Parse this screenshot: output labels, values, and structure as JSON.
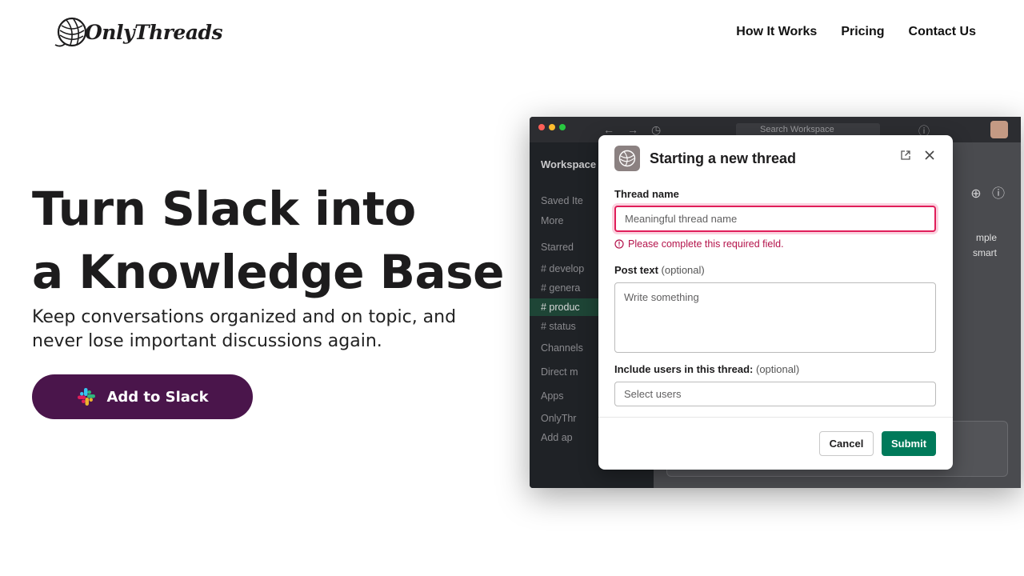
{
  "header": {
    "logo_text": "OnlyThreads",
    "nav": [
      "How It Works",
      "Pricing",
      "Contact Us"
    ]
  },
  "hero": {
    "title_line1": "Turn Slack into",
    "title_line2": "a Knowledge Base",
    "subtitle": "Keep conversations organized and on topic, and never lose important discussions again.",
    "cta_label": "Add to Slack",
    "cta_color": "#4a154b"
  },
  "app_window": {
    "search_placeholder": "Search Workspace",
    "workspace_name": "Workspace",
    "sidebar_items": [
      "Saved Ite",
      "More",
      "Starred",
      "# develop",
      "# genera",
      "# produc",
      "# status",
      "Channels",
      "Direct m",
      "Apps",
      "OnlyThr",
      "Add ap"
    ],
    "main_text_lines": [
      "mple",
      "smart"
    ]
  },
  "modal": {
    "title": "Starting a new thread",
    "thread_name_label": "Thread name",
    "thread_name_placeholder": "Meaningful thread name",
    "thread_name_value": "",
    "error_text": "Please complete this required field.",
    "post_text_label": "Post text",
    "post_text_optional": "(optional)",
    "post_text_placeholder": "Write something",
    "users_label": "Include users in this thread:",
    "users_optional": "(optional)",
    "users_placeholder": "Select users",
    "cancel_label": "Cancel",
    "submit_label": "Submit",
    "submit_color": "#007a5a",
    "error_color": "#e01e5a"
  }
}
